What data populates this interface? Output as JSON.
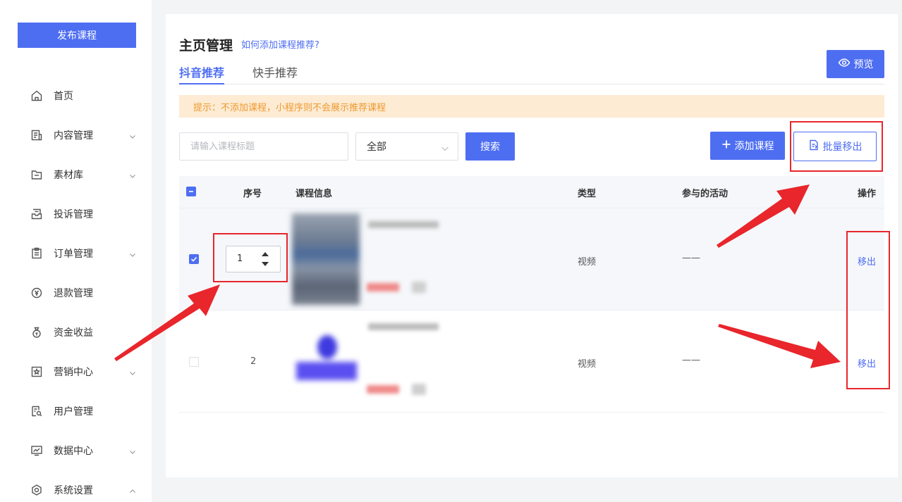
{
  "sidebar": {
    "publish_label": "发布课程",
    "items": [
      {
        "label": "首页",
        "icon": "home-icon",
        "expandable": false
      },
      {
        "label": "内容管理",
        "icon": "content-icon",
        "expandable": true,
        "chevron": "chevron-down-icon"
      },
      {
        "label": "素材库",
        "icon": "folder-icon",
        "expandable": true,
        "chevron": "chevron-down-icon"
      },
      {
        "label": "投诉管理",
        "icon": "inbox-icon",
        "expandable": false
      },
      {
        "label": "订单管理",
        "icon": "clipboard-icon",
        "expandable": true,
        "chevron": "chevron-down-icon"
      },
      {
        "label": "退款管理",
        "icon": "yen-icon",
        "expandable": false
      },
      {
        "label": "资金收益",
        "icon": "money-bag-icon",
        "expandable": false
      },
      {
        "label": "营销中心",
        "icon": "star-box-icon",
        "expandable": true,
        "chevron": "chevron-down-icon"
      },
      {
        "label": "用户管理",
        "icon": "user-search-icon",
        "expandable": false
      },
      {
        "label": "数据中心",
        "icon": "chart-monitor-icon",
        "expandable": true,
        "chevron": "chevron-down-icon"
      },
      {
        "label": "系统设置",
        "icon": "settings-icon",
        "expandable": true,
        "chevron": "chevron-up-icon"
      }
    ]
  },
  "header": {
    "title": "主页管理",
    "help_link": "如何添加课程推荐?",
    "preview_label": "预览"
  },
  "tabs": [
    {
      "label": "抖音推荐",
      "active": true
    },
    {
      "label": "快手推荐",
      "active": false
    }
  ],
  "notice": "提示：不添加课程，小程序则不会展示推荐课程",
  "filters": {
    "search_placeholder": "请输入课程标题",
    "select_value": "全部",
    "search_label": "搜索"
  },
  "actions": {
    "add_label": "添加课程",
    "batch_remove_label": "批量移出"
  },
  "table": {
    "headers": [
      "序号",
      "课程信息",
      "类型",
      "参与的活动",
      "操作"
    ],
    "rows": [
      {
        "order": "1",
        "type": "视频",
        "activity": "——",
        "action": "移出",
        "checked": true
      },
      {
        "order": "2",
        "type": "视频",
        "activity": "——",
        "action": "移出",
        "checked": false
      }
    ]
  },
  "colors": {
    "primary": "#4e6ef2",
    "notice_bg": "#fdebd3",
    "notice_text": "#ee9a30",
    "annotation_red": "#e8262c"
  }
}
